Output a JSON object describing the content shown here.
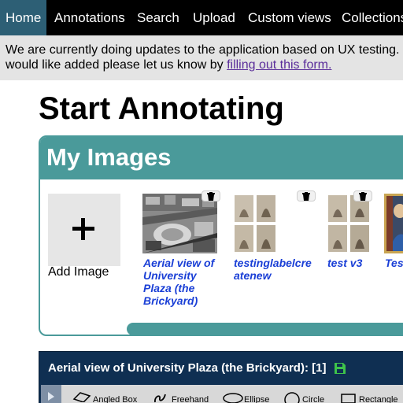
{
  "nav": {
    "items": [
      {
        "label": "Home",
        "active": true
      },
      {
        "label": "Annotations",
        "active": false
      },
      {
        "label": "Search",
        "active": false
      },
      {
        "label": "Upload",
        "active": false
      },
      {
        "label": "Custom views",
        "active": false
      },
      {
        "label": "Collections",
        "active": false
      }
    ]
  },
  "notice": {
    "line1": "We are currently doing updates to the application based on UX testing.",
    "line2_prefix": "would like added please let us know by ",
    "link_text": "filling out this form."
  },
  "page_title": "Start Annotating",
  "my_images": {
    "title": "My Images",
    "add_label": "Add Image",
    "images": [
      {
        "title": "Aerial view of University Plaza (the Brickyard)",
        "title_lines": [
          "Aerial view of",
          "University",
          "Plaza (the",
          "Brickyard)"
        ],
        "has_delete": true
      },
      {
        "title": "testinglabelcreatenew",
        "title_lines": [
          "testinglabelcre",
          "atenew"
        ],
        "has_delete": true
      },
      {
        "title": "test v3",
        "title_lines": [
          "test v3"
        ],
        "has_delete": true
      },
      {
        "title": "Tes",
        "title_lines": [
          "Tes"
        ],
        "has_delete": false
      }
    ]
  },
  "editor": {
    "title": "Aerial view of University Plaza (the Brickyard): [1]",
    "tools": [
      "Angled Box",
      "Freehand",
      "Ellipse",
      "Circle",
      "Rectangle"
    ]
  },
  "colors": {
    "nav_bg": "#000000",
    "nav_active": "#2d5f75",
    "panel_teal": "#4a9a9a",
    "title_link": "#1a3fd6",
    "editor_bg": "#0f2f52",
    "save_green": "#3fc44a"
  }
}
